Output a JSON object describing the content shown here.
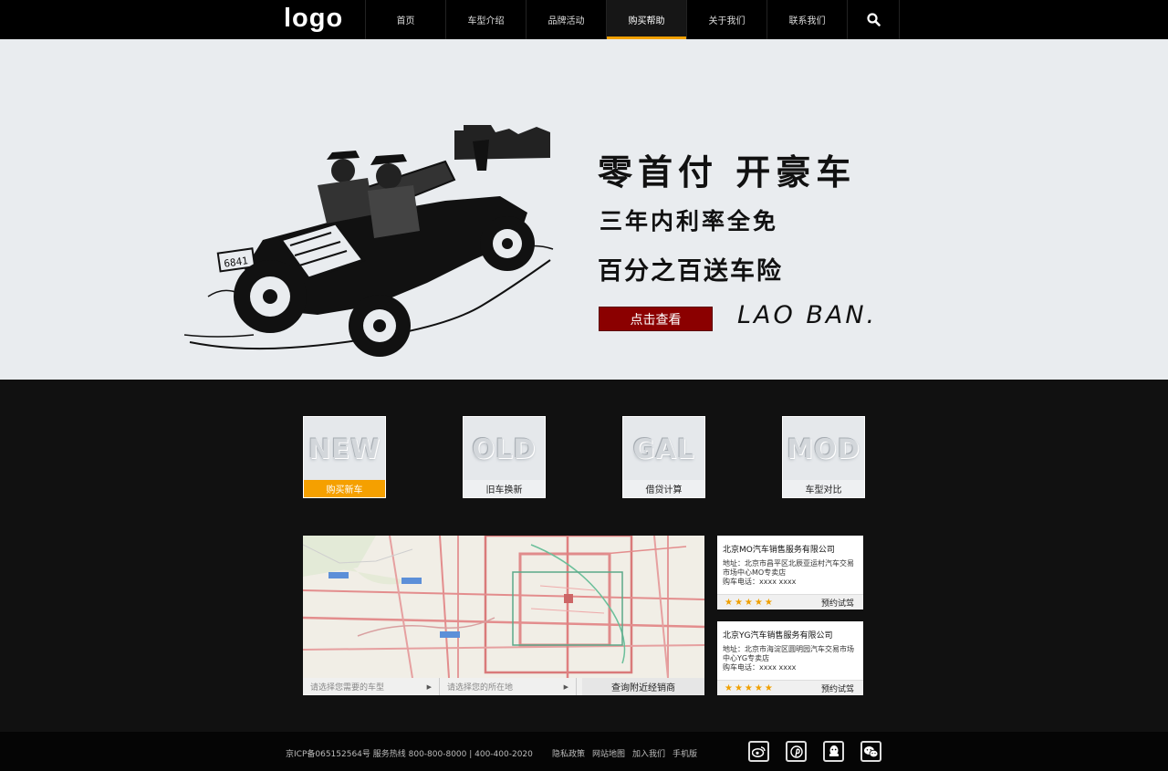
{
  "header": {
    "logo": "logo",
    "nav": [
      "首页",
      "车型介绍",
      "品牌活动",
      "购买帮助",
      "关于我们",
      "联系我们"
    ],
    "active_nav": "购买帮助",
    "search_icon": "search-icon"
  },
  "banner": {
    "slogan_main": "零首付 开豪车",
    "slogan_2": "三年内利率全免",
    "slogan_3": "百分之百送车险",
    "cta": "点击查看",
    "brand_script": "LAO BAN.",
    "art": "vintage-car-illustration"
  },
  "services": [
    {
      "word": "NEW",
      "label": "购买新车"
    },
    {
      "word": "OLD",
      "label": "旧车换新"
    },
    {
      "word": "GAL",
      "label": "借贷计算"
    },
    {
      "word": "MOD",
      "label": "车型对比"
    }
  ],
  "map": {
    "select_model_placeholder": "请选择您需要的车型",
    "select_location_placeholder": "请选择您的所在地",
    "search_button": "查询附近经销商"
  },
  "dealers": [
    {
      "name": "北京MO汽车销售服务有限公司",
      "address": "地址：北京市昌平区北辰亚运村汽车交易市场中心MO专卖店",
      "phone": "购车电话：xxxx xxxx",
      "rating": "★★★★★",
      "action": "预约试驾"
    },
    {
      "name": "北京YG汽车销售服务有限公司",
      "address": "地址：北京市海淀区圆明园汽车交易市场中心YG专卖店",
      "phone": "购车电话：xxxx xxxx",
      "rating": "★★★★★",
      "action": "预约试驾"
    }
  ],
  "footer": {
    "info": "京ICP备065152564号 服务热线 800-800-8000 | 400-400-2020",
    "links": [
      "隐私政策",
      "网站地图",
      "加入我们",
      "手机版"
    ],
    "social_icons": [
      "weibo-icon",
      "pinterest-icon",
      "qq-icon",
      "wechat-icon"
    ]
  },
  "colors": {
    "accent": "#f0a000",
    "cta": "#8b0000",
    "banner_bg": "#e9ecef",
    "page_bg": "#111111"
  }
}
